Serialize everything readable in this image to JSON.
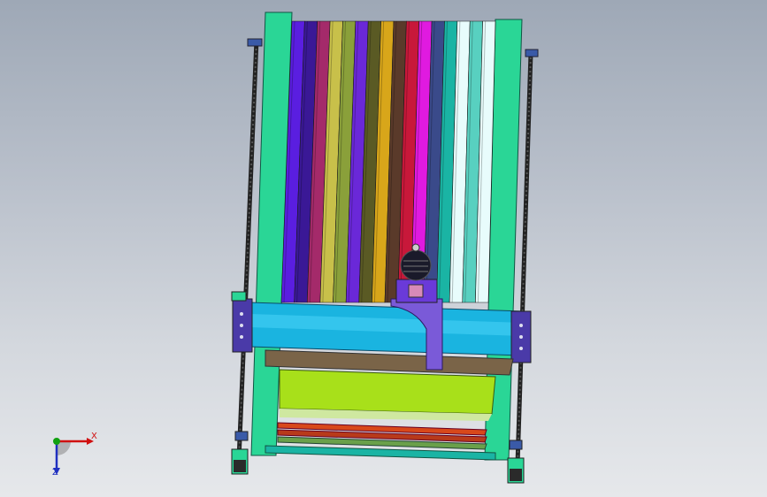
{
  "viewport": {
    "background_top": "#9ea8b6",
    "background_bottom": "#e6e8eb"
  },
  "model": {
    "strip_colors": [
      "#5a1ee0",
      "#3a1896",
      "#a42a6a",
      "#c8c04a",
      "#8aa03a",
      "#6a28d8",
      "#5a5a24",
      "#d8a61a",
      "#5a3a2a",
      "#c8183a",
      "#e01ae0",
      "#3a4a8a",
      "#1ab4a4",
      "#e8fcfc",
      "#58d0c0",
      "#e8fcfc"
    ],
    "frame_color": "#2ad696",
    "gantry_color": "#1ab4e0",
    "bed_color": "#a8e01a",
    "rail_color": "#d8481a",
    "carriage_color": "#7a5ad8",
    "base_color": "#7a6448"
  },
  "triad": {
    "x_label": "X",
    "z_label": "Z",
    "x_color": "#d01010",
    "y_color": "#10a010",
    "z_color": "#2030c0"
  }
}
